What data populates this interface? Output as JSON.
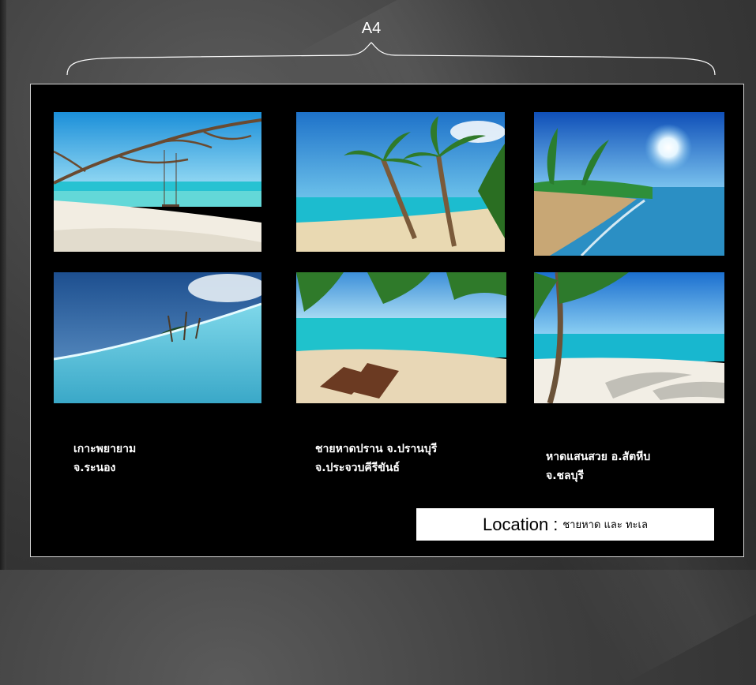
{
  "slide": {
    "page_label": "A4"
  },
  "photos": [
    {
      "name": "beach-photo-swing-tree"
    },
    {
      "name": "beach-photo-palm-leaning"
    },
    {
      "name": "beach-photo-sun-shore"
    },
    {
      "name": "beach-photo-island-wave"
    },
    {
      "name": "beach-photo-deck-chairs"
    },
    {
      "name": "beach-photo-palm-shadow"
    }
  ],
  "captions": [
    {
      "line1": "เกาะพยายาม",
      "line2": "จ.ระนอง"
    },
    {
      "line1": "ชายหาดปราน จ.ปรานบุรี",
      "line2": "จ.ประจวบคีรีขันธ์"
    },
    {
      "line1": "หาดแสนสวย อ.สัตหีบ",
      "line2": "จ.ชลบุรี"
    }
  ],
  "location": {
    "label": "Location",
    "separator": ":",
    "value": "ชายหาด และ ทะเล"
  },
  "colors": {
    "sheet_background": "#000000",
    "sky": "#3fa9e6",
    "sea": "#2cc6d3",
    "sand": "#efe6d4"
  }
}
